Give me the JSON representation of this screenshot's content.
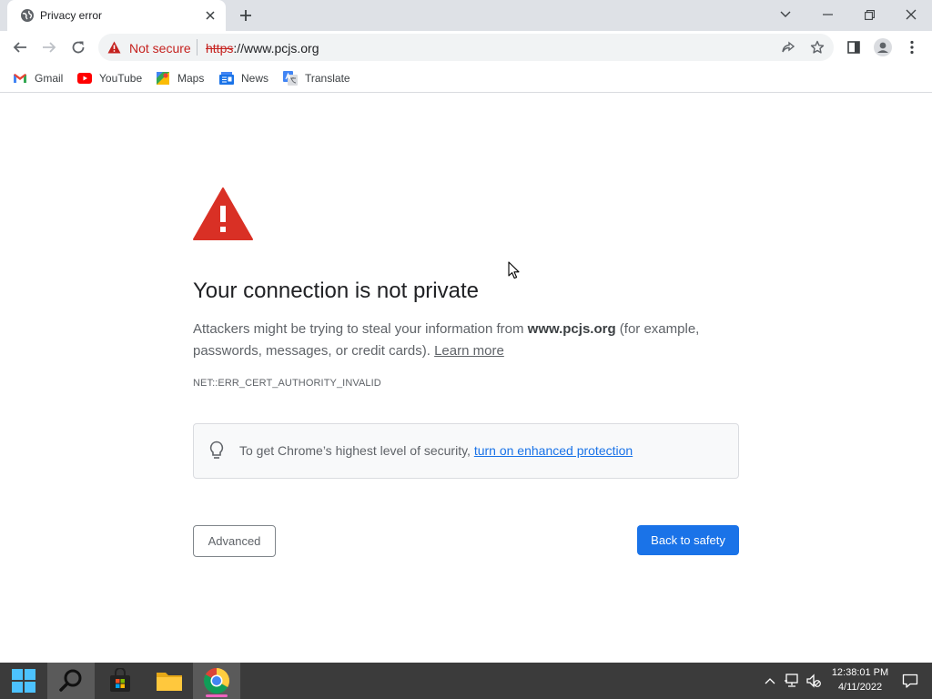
{
  "browser": {
    "tab": {
      "title": "Privacy error",
      "favicon": "globe-icon"
    },
    "address_bar": {
      "security_label": "Not secure",
      "url_scheme": "https",
      "url_rest": "://www.pcjs.org"
    },
    "bookmarks": [
      {
        "label": "Gmail",
        "icon": "gmail-icon"
      },
      {
        "label": "YouTube",
        "icon": "youtube-icon"
      },
      {
        "label": "Maps",
        "icon": "maps-icon"
      },
      {
        "label": "News",
        "icon": "news-icon"
      },
      {
        "label": "Translate",
        "icon": "translate-icon"
      }
    ]
  },
  "page": {
    "heading": "Your connection is not private",
    "explanation_prefix": "Attackers might be trying to steal your information from ",
    "explanation_host": "www.pcjs.org",
    "explanation_suffix": " (for example, passwords, messages, or credit cards). ",
    "learn_more": "Learn more",
    "error_code": "NET::ERR_CERT_AUTHORITY_INVALID",
    "protection_prefix": "To get Chrome’s highest level of security, ",
    "protection_link": "turn on enhanced protection",
    "advanced_label": "Advanced",
    "back_label": "Back to safety"
  },
  "taskbar": {
    "apps": [
      "start-icon",
      "search-icon",
      "store-icon",
      "file-explorer-icon",
      "chrome-icon"
    ],
    "active_app": "chrome-icon",
    "clock_time": "12:38:01 PM",
    "clock_date": "4/11/2022"
  },
  "colors": {
    "danger": "#d93025",
    "accent": "#1a73e8",
    "taskbar": "#3b3b3b"
  }
}
